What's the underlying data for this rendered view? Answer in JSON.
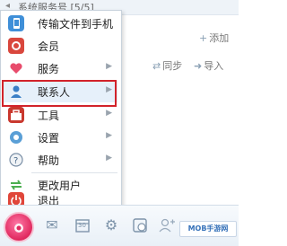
{
  "background": {
    "group_header": "系统服务号 [5/5]",
    "add_label": "添加",
    "sync_label": "同步",
    "import_label": "导入"
  },
  "menu": {
    "items": [
      {
        "label": "传输文件到手机",
        "icon": "phone-icon",
        "submenu": false
      },
      {
        "label": "会员",
        "icon": "vip-icon",
        "submenu": false
      },
      {
        "label": "服务",
        "icon": "heart-icon",
        "submenu": true
      },
      {
        "label": "联系人",
        "icon": "contact-icon",
        "submenu": true,
        "highlighted": true
      },
      {
        "label": "工具",
        "icon": "toolbox-icon",
        "submenu": true
      },
      {
        "label": "设置",
        "icon": "settings-icon",
        "submenu": true
      },
      {
        "label": "帮助",
        "icon": "help-icon",
        "submenu": true
      },
      {
        "label": "更改用户",
        "icon": "switch-user-icon",
        "submenu": false
      },
      {
        "label": "退出",
        "icon": "power-icon",
        "submenu": false
      }
    ]
  },
  "toolbar": {
    "buttons": [
      "start-menu-button",
      "mail-button",
      "calendar-button",
      "settings-button",
      "history-button",
      "add-contact-button"
    ],
    "calendar_day": "30"
  },
  "watermark": "MOB手游网"
}
